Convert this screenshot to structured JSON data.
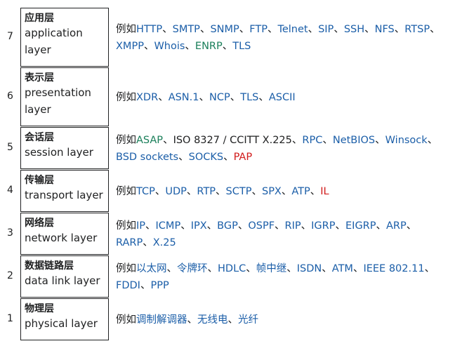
{
  "colors": {
    "link": "#1b5ea8",
    "visited": "#1a7f5a",
    "new": "#d11a1a",
    "text": "#202122"
  },
  "prefix": "例如",
  "separator": "、",
  "rows": [
    {
      "number": "7",
      "zh": "应用层",
      "en": "application layer",
      "protocols": [
        {
          "t": "HTTP",
          "c": "link"
        },
        {
          "t": "SMTP",
          "c": "link"
        },
        {
          "t": "SNMP",
          "c": "link"
        },
        {
          "t": "FTP",
          "c": "link"
        },
        {
          "t": "Telnet",
          "c": "link"
        },
        {
          "t": "SIP",
          "c": "link"
        },
        {
          "t": "SSH",
          "c": "link"
        },
        {
          "t": "NFS",
          "c": "link"
        },
        {
          "t": "RTSP",
          "c": "link"
        },
        {
          "t": "XMPP",
          "c": "link"
        },
        {
          "t": "Whois",
          "c": "link"
        },
        {
          "t": "ENRP",
          "c": "visited"
        },
        {
          "t": "TLS",
          "c": "link"
        }
      ]
    },
    {
      "number": "6",
      "zh": "表示层",
      "en": "presentation layer",
      "protocols": [
        {
          "t": "XDR",
          "c": "link"
        },
        {
          "t": "ASN.1",
          "c": "link"
        },
        {
          "t": "NCP",
          "c": "link"
        },
        {
          "t": "TLS",
          "c": "link"
        },
        {
          "t": "ASCII",
          "c": "link"
        }
      ]
    },
    {
      "number": "5",
      "zh": "会话层",
      "en": "session layer",
      "protocols": [
        {
          "t": "ASAP",
          "c": "visited"
        },
        {
          "t": "ISO 8327 / CCITT X.225",
          "c": "text"
        },
        {
          "t": "RPC",
          "c": "link"
        },
        {
          "t": "NetBIOS",
          "c": "link"
        },
        {
          "t": "Winsock",
          "c": "link"
        },
        {
          "t": "BSD sockets",
          "c": "link"
        },
        {
          "t": "SOCKS",
          "c": "link"
        },
        {
          "t": "PAP",
          "c": "new"
        }
      ]
    },
    {
      "number": "4",
      "zh": "传输层",
      "en": "transport layer",
      "protocols": [
        {
          "t": "TCP",
          "c": "link"
        },
        {
          "t": "UDP",
          "c": "link"
        },
        {
          "t": "RTP",
          "c": "link"
        },
        {
          "t": "SCTP",
          "c": "link"
        },
        {
          "t": "SPX",
          "c": "link"
        },
        {
          "t": "ATP",
          "c": "link"
        },
        {
          "t": "IL",
          "c": "new"
        }
      ]
    },
    {
      "number": "3",
      "zh": "网络层",
      "en": "network layer",
      "protocols": [
        {
          "t": "IP",
          "c": "link"
        },
        {
          "t": "ICMP",
          "c": "link"
        },
        {
          "t": "IPX",
          "c": "link"
        },
        {
          "t": "BGP",
          "c": "link"
        },
        {
          "t": "OSPF",
          "c": "link"
        },
        {
          "t": "RIP",
          "c": "link"
        },
        {
          "t": "IGRP",
          "c": "link"
        },
        {
          "t": "EIGRP",
          "c": "link"
        },
        {
          "t": "ARP",
          "c": "link"
        },
        {
          "t": "RARP",
          "c": "link"
        },
        {
          "t": "X.25",
          "c": "link"
        }
      ]
    },
    {
      "number": "2",
      "zh": "数据链路层",
      "en": "data link layer",
      "protocols": [
        {
          "t": "以太网",
          "c": "link"
        },
        {
          "t": "令牌环",
          "c": "link"
        },
        {
          "t": "HDLC",
          "c": "link"
        },
        {
          "t": "帧中继",
          "c": "link"
        },
        {
          "t": "ISDN",
          "c": "link"
        },
        {
          "t": "ATM",
          "c": "link"
        },
        {
          "t": "IEEE 802.11",
          "c": "link"
        },
        {
          "t": "FDDI",
          "c": "link"
        },
        {
          "t": "PPP",
          "c": "link"
        }
      ]
    },
    {
      "number": "1",
      "zh": "物理层",
      "en": "physical layer",
      "protocols": [
        {
          "t": "调制解调器",
          "c": "link"
        },
        {
          "t": "无线电",
          "c": "link"
        },
        {
          "t": "光纤",
          "c": "link"
        }
      ]
    }
  ]
}
